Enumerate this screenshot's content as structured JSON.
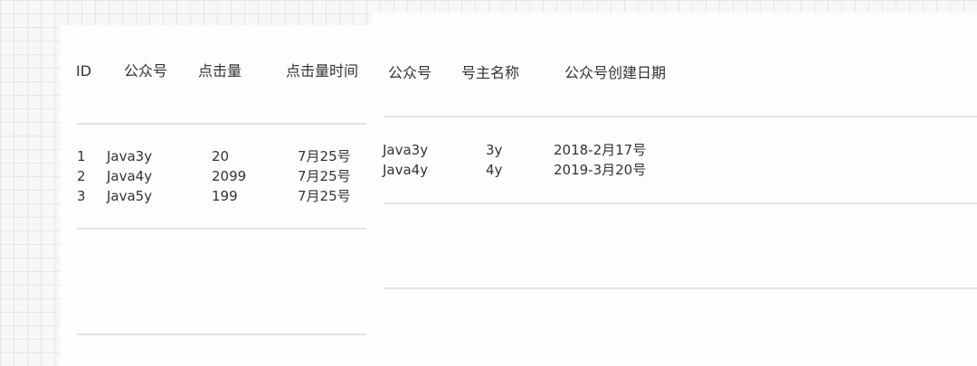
{
  "table_left": {
    "headers": [
      "ID",
      "公众号",
      "点击量",
      "点击量时间"
    ],
    "rows": [
      [
        "1",
        "Java3y",
        "20",
        "7月25号"
      ],
      [
        "2",
        "Java4y",
        "2099",
        "7月25号"
      ],
      [
        "3",
        "Java5y",
        "199",
        "7月25号"
      ]
    ]
  },
  "table_right": {
    "headers": [
      "公众号",
      "号主名称",
      "公众号创建日期"
    ],
    "rows": [
      [
        "Java3y",
        "3y",
        "2018-2月17号"
      ],
      [
        "Java4y",
        "4y",
        "2019-3月20号"
      ]
    ]
  }
}
